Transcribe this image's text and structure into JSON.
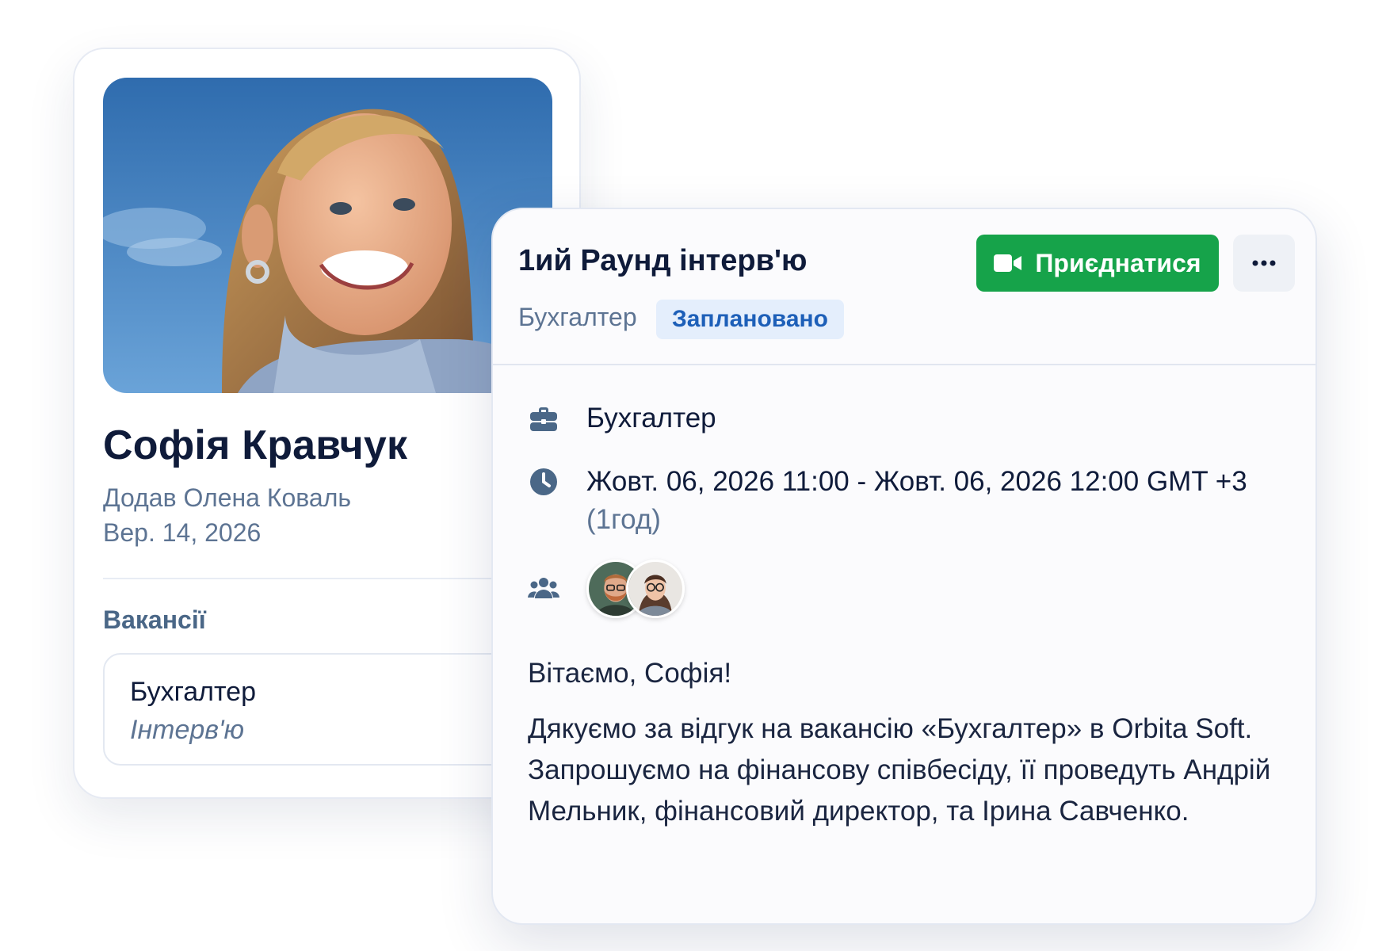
{
  "candidate": {
    "name": "Софія Кравчук",
    "added_by": "Додав Олена Коваль",
    "added_date": "Вер. 14, 2026",
    "vacancies_heading": "Вакансії",
    "vacancy": {
      "title": "Бухгалтер",
      "stage": "Інтерв'ю"
    }
  },
  "interview": {
    "title": "1ий Раунд інтерв'ю",
    "join_label": "Приєднатися",
    "role": "Бухгалтер",
    "status": "Заплановано",
    "position": "Бухгалтер",
    "time_range": "Жовт. 06, 2026 11:00 - Жовт. 06, 2026 12:00 GMT +3",
    "duration": "(1год)",
    "greeting": "Вітаємо, Софія!",
    "message": "Дякуємо за відгук на вакансію «Бухгалтер» в Orbita Soft. Запрошуємо на фінансову співбесіду, її проведуть Андрій Мельник, фінансовий директор, та Ірина Савченко."
  },
  "icons": {
    "position": "briefcase-icon",
    "time": "clock-icon",
    "participants": "users-icon",
    "join": "video-camera-icon",
    "more": "more-horizontal-icon"
  },
  "colors": {
    "primary_green": "#16a34a",
    "badge_bg": "#e4eefc",
    "badge_text": "#1d5fb8",
    "muted_text": "#5d7493",
    "icon": "#4a6787"
  }
}
